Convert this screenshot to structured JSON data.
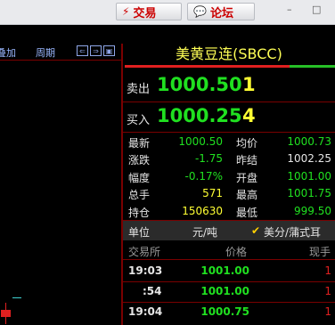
{
  "toolbar": {
    "trade": {
      "label": "交易",
      "icon": "lightning-icon"
    },
    "forum": {
      "label": "论坛",
      "icon": "chat-bubble-icon"
    },
    "window_controls": [
      "–",
      "□"
    ]
  },
  "left_header": {
    "overlay": "叠加",
    "period": "周期"
  },
  "quote": {
    "title": "美黄豆连(SBCC)",
    "ask_label": "卖出",
    "ask_price": "1000.50",
    "ask_qty": "1",
    "bid_label": "买入",
    "bid_price": "1000.25",
    "bid_qty": "4",
    "stats": [
      {
        "k1": "最新",
        "v1": "1000.50",
        "c1": "#20e020",
        "k2": "均价",
        "v2": "1000.73",
        "c2": "#20e020"
      },
      {
        "k1": "涨跌",
        "v1": "-1.75",
        "c1": "#20e020",
        "k2": "昨结",
        "v2": "1002.25",
        "c2": "#e6e6e6"
      },
      {
        "k1": "幅度",
        "v1": "-0.17%",
        "c1": "#20e020",
        "k2": "开盘",
        "v2": "1001.00",
        "c2": "#20e020"
      },
      {
        "k1": "总手",
        "v1": "571",
        "c1": "#ffff33",
        "k2": "最高",
        "v2": "1001.75",
        "c2": "#20e020"
      },
      {
        "k1": "持仓",
        "v1": "150630",
        "c1": "#ffff33",
        "k2": "最低",
        "v2": "999.50",
        "c2": "#20e020"
      }
    ],
    "unit": {
      "label": "单位",
      "value": "元/吨",
      "check": "✔",
      "alt": "美分/蒲式耳"
    },
    "trades_header": {
      "time": "交易所",
      "price": "价格",
      "qty": "现手"
    },
    "trades": [
      {
        "time": "19:03",
        "price": "1001.00",
        "qty": "1"
      },
      {
        "time": ":54",
        "price": "1001.00",
        "qty": "1"
      },
      {
        "time": "19:04",
        "price": "1000.75",
        "qty": "1"
      }
    ]
  },
  "colors": {
    "up": "#e02020",
    "down": "#20e020",
    "volume": "#ffff33",
    "accent": "#7a0000"
  }
}
